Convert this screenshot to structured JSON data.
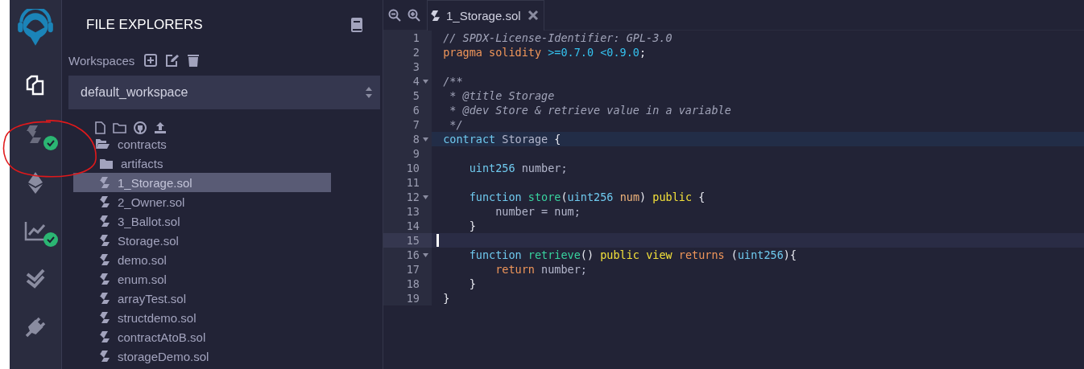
{
  "activity_bar": [
    {
      "kind": "files",
      "selected": true,
      "badge": false
    },
    {
      "kind": "compiler",
      "selected": false,
      "badge": true
    },
    {
      "kind": "deploy",
      "selected": false,
      "badge": false
    },
    {
      "kind": "analysis",
      "selected": false,
      "badge": true
    },
    {
      "kind": "tests",
      "selected": false,
      "badge": false
    },
    {
      "kind": "plugins",
      "selected": false,
      "badge": false
    }
  ],
  "explorer": {
    "title": "FILE EXPLORERS",
    "workspaces_label": "Workspaces",
    "workspace": "default_workspace",
    "tree": [
      {
        "name": "contracts",
        "kind": "folder",
        "expanded": true,
        "selected": false,
        "children": [
          {
            "name": "artifacts",
            "kind": "folder",
            "expanded": false,
            "selected": false
          },
          {
            "name": "1_Storage.sol",
            "kind": "file",
            "selected": true
          },
          {
            "name": "2_Owner.sol",
            "kind": "file",
            "selected": false
          },
          {
            "name": "3_Ballot.sol",
            "kind": "file",
            "selected": false
          },
          {
            "name": "Storage.sol",
            "kind": "file",
            "selected": false
          },
          {
            "name": "demo.sol",
            "kind": "file",
            "selected": false
          },
          {
            "name": "enum.sol",
            "kind": "file",
            "selected": false
          },
          {
            "name": "arrayTest.sol",
            "kind": "file",
            "selected": false
          },
          {
            "name": "structdemo.sol",
            "kind": "file",
            "selected": false
          },
          {
            "name": "contractAtoB.sol",
            "kind": "file",
            "selected": false
          },
          {
            "name": "storageDemo.sol",
            "kind": "file",
            "selected": false
          }
        ]
      }
    ]
  },
  "editor": {
    "tabs": [
      {
        "label": "1_Storage.sol",
        "selected": true
      }
    ],
    "lines": [
      {
        "number": "1",
        "fold": false,
        "highlighted": false,
        "current": false,
        "tokens": [
          {
            "t": "// SPDX-License-Identifier: GPL-3.0",
            "kind": "comment"
          }
        ]
      },
      {
        "number": "2",
        "fold": false,
        "highlighted": false,
        "current": false,
        "tokens": [
          {
            "t": "pragma solidity ",
            "kind": "keyword"
          },
          {
            "t": ">=0.7.0 <0.9.0",
            "kind": "version"
          },
          {
            "t": ";",
            "kind": "punct"
          }
        ]
      },
      {
        "number": "3",
        "fold": false,
        "highlighted": false,
        "current": false
      },
      {
        "number": "4",
        "fold": true,
        "highlighted": false,
        "current": false,
        "tokens": [
          {
            "t": "/**",
            "kind": "comment"
          }
        ]
      },
      {
        "number": "5",
        "fold": false,
        "highlighted": false,
        "current": false,
        "tokens": [
          {
            "t": " * @title Storage",
            "kind": "comment"
          }
        ]
      },
      {
        "number": "6",
        "fold": false,
        "highlighted": false,
        "current": false,
        "tokens": [
          {
            "t": " * @dev Store & retrieve value in a variable",
            "kind": "comment"
          }
        ]
      },
      {
        "number": "7",
        "fold": false,
        "highlighted": false,
        "current": false,
        "tokens": [
          {
            "t": " */",
            "kind": "comment"
          }
        ]
      },
      {
        "number": "8",
        "fold": true,
        "highlighted": true,
        "current": false,
        "tokens": [
          {
            "t": "contract",
            "kind": "type"
          },
          {
            "t": " Storage ",
            "kind": "ident"
          },
          {
            "t": "{",
            "kind": "punct"
          }
        ]
      },
      {
        "number": "9",
        "fold": false,
        "highlighted": false,
        "current": false
      },
      {
        "number": "10",
        "fold": false,
        "highlighted": false,
        "current": false,
        "tokens": [
          {
            "t": "    uint256",
            "kind": "type"
          },
          {
            "t": " number;",
            "kind": "ident"
          }
        ]
      },
      {
        "number": "11",
        "fold": false,
        "highlighted": false,
        "current": false
      },
      {
        "number": "12",
        "fold": true,
        "highlighted": false,
        "current": false,
        "tokens": [
          {
            "t": "    function ",
            "kind": "type"
          },
          {
            "t": "store",
            "kind": "func"
          },
          {
            "t": "(",
            "kind": "punct"
          },
          {
            "t": "uint256",
            "kind": "type"
          },
          {
            "t": " num",
            "kind": "param"
          },
          {
            "t": ") ",
            "kind": "punct"
          },
          {
            "t": "public",
            "kind": "modifier"
          },
          {
            "t": " {",
            "kind": "punct"
          }
        ]
      },
      {
        "number": "13",
        "fold": false,
        "highlighted": false,
        "current": false,
        "tokens": [
          {
            "t": "        number = num;",
            "kind": "ident"
          }
        ]
      },
      {
        "number": "14",
        "fold": false,
        "highlighted": false,
        "current": false,
        "tokens": [
          {
            "t": "    }",
            "kind": "punct"
          }
        ]
      },
      {
        "number": "15",
        "fold": false,
        "highlighted": false,
        "current": true
      },
      {
        "number": "16",
        "fold": true,
        "highlighted": false,
        "current": false,
        "tokens": [
          {
            "t": "    function ",
            "kind": "type"
          },
          {
            "t": "retrieve",
            "kind": "func"
          },
          {
            "t": "() ",
            "kind": "punct"
          },
          {
            "t": "public view",
            "kind": "modifier"
          },
          {
            "t": " returns",
            "kind": "keyword"
          },
          {
            "t": " (",
            "kind": "punct"
          },
          {
            "t": "uint256",
            "kind": "type"
          },
          {
            "t": "){",
            "kind": "punct"
          }
        ]
      },
      {
        "number": "17",
        "fold": false,
        "highlighted": false,
        "current": false,
        "tokens": [
          {
            "t": "        return",
            "kind": "keyword"
          },
          {
            "t": " number;",
            "kind": "ident"
          }
        ]
      },
      {
        "number": "18",
        "fold": false,
        "highlighted": false,
        "current": false,
        "tokens": [
          {
            "t": "    }",
            "kind": "punct"
          }
        ]
      },
      {
        "number": "19",
        "fold": false,
        "highlighted": false,
        "current": false,
        "tokens": [
          {
            "t": "}",
            "kind": "punct"
          }
        ]
      }
    ]
  }
}
